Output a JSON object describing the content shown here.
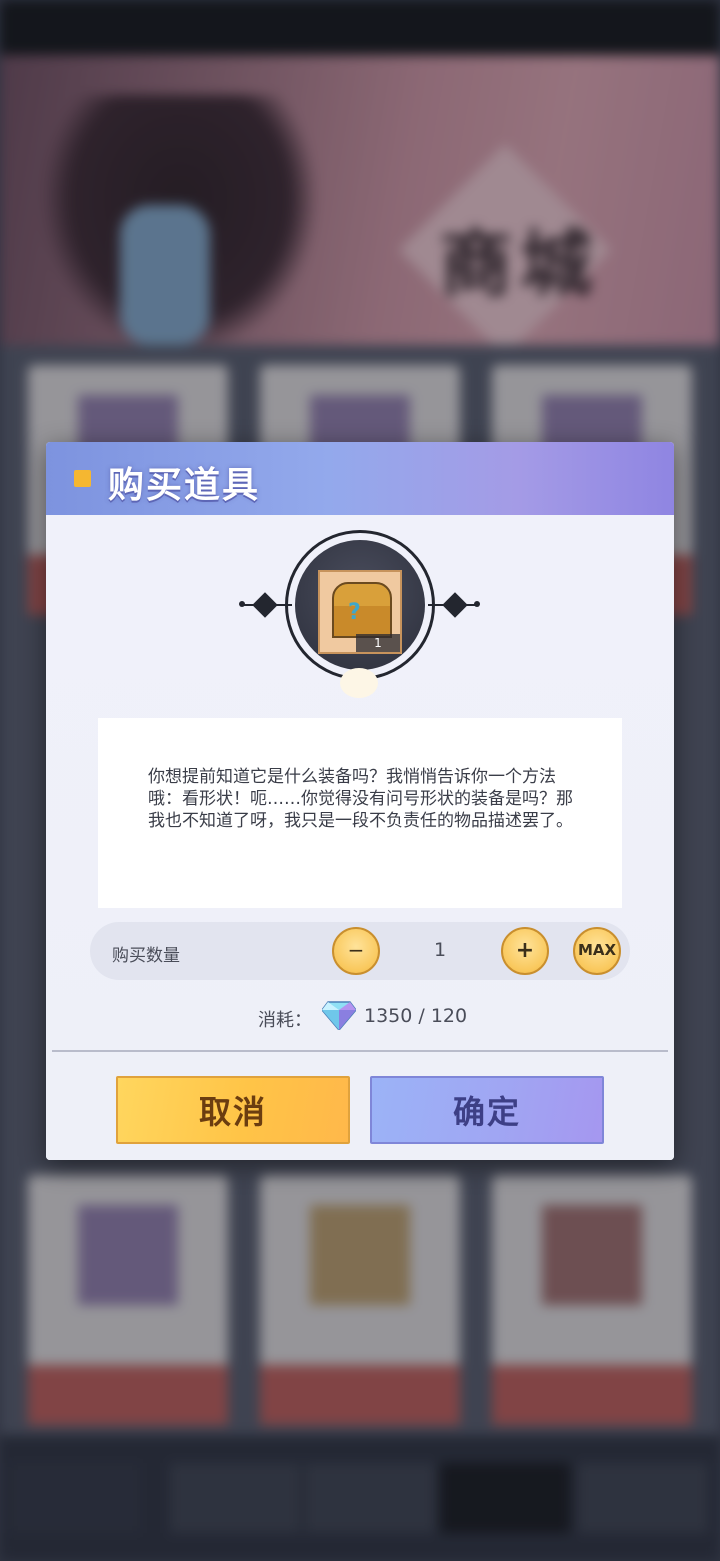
{
  "background": {
    "banner_title": "商城"
  },
  "dialog": {
    "title": "购买道具",
    "item": {
      "icon": "treasure-chest-icon",
      "count": "1"
    },
    "description": "你想提前知道它是什么装备吗？我悄悄告诉你一个方法哦：看形状！呃……你觉得没有问号形状的装备是吗？那我也不知道了呀，我只是一段不负责任的物品描述罢了。",
    "quantity": {
      "label": "购买数量",
      "minus": "−",
      "value": "1",
      "plus": "+",
      "max": "MAX"
    },
    "cost": {
      "label": "消耗：",
      "icon": "diamond-gem-icon",
      "value": "1350 / 120"
    },
    "buttons": {
      "cancel": "取消",
      "confirm": "确定"
    }
  },
  "colors": {
    "header_gradient_start": "#7d93df",
    "header_gradient_end": "#8f85e2",
    "cancel_button": "#ffc447",
    "confirm_button": "#a0a6f3",
    "header_mark": "#f5b731"
  }
}
